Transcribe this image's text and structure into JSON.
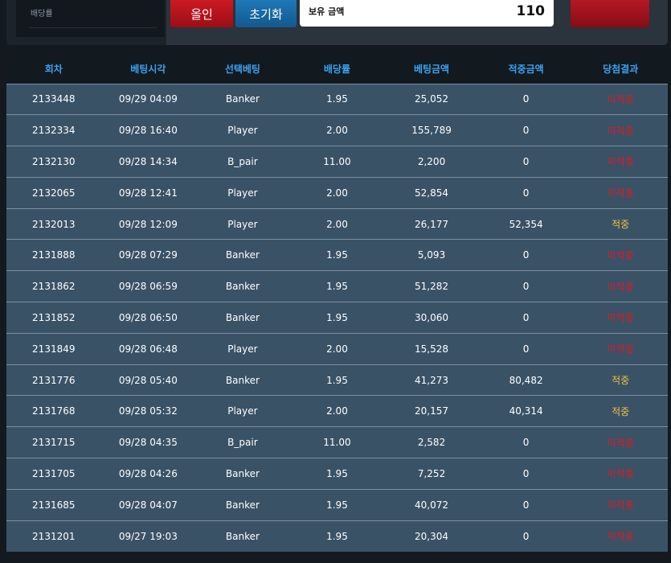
{
  "controls": {
    "odds_label": "배당률",
    "allin_label": "올인",
    "reset_label": "초기화",
    "holding_label": "보유 금액",
    "holding_value": "110"
  },
  "table": {
    "headers": [
      "회차",
      "베팅시각",
      "선택베팅",
      "배당률",
      "베팅금액",
      "적중금액",
      "당첨결과"
    ],
    "rows": [
      [
        "2133448",
        "09/29 04:09",
        "Banker",
        "1.95",
        "25,052",
        "0",
        "미적중"
      ],
      [
        "2132334",
        "09/28 16:40",
        "Player",
        "2.00",
        "155,789",
        "0",
        "미적중"
      ],
      [
        "2132130",
        "09/28 14:34",
        "B_pair",
        "11.00",
        "2,200",
        "0",
        "미적중"
      ],
      [
        "2132065",
        "09/28 12:41",
        "Player",
        "2.00",
        "52,854",
        "0",
        "미적중"
      ],
      [
        "2132013",
        "09/28 12:09",
        "Player",
        "2.00",
        "26,177",
        "52,354",
        "적중"
      ],
      [
        "2131888",
        "09/28 07:29",
        "Banker",
        "1.95",
        "5,093",
        "0",
        "미적중"
      ],
      [
        "2131862",
        "09/28 06:59",
        "Banker",
        "1.95",
        "51,282",
        "0",
        "미적중"
      ],
      [
        "2131852",
        "09/28 06:50",
        "Banker",
        "1.95",
        "30,060",
        "0",
        "미적중"
      ],
      [
        "2131849",
        "09/28 06:48",
        "Player",
        "2.00",
        "15,528",
        "0",
        "미적중"
      ],
      [
        "2131776",
        "09/28 05:40",
        "Banker",
        "1.95",
        "41,273",
        "80,482",
        "적중"
      ],
      [
        "2131768",
        "09/28 05:32",
        "Player",
        "2.00",
        "20,157",
        "40,314",
        "적중"
      ],
      [
        "2131715",
        "09/28 04:35",
        "B_pair",
        "11.00",
        "2,582",
        "0",
        "미적중"
      ],
      [
        "2131705",
        "09/28 04:26",
        "Banker",
        "1.95",
        "7,252",
        "0",
        "미적중"
      ],
      [
        "2131685",
        "09/28 04:07",
        "Banker",
        "1.95",
        "40,072",
        "0",
        "미적중"
      ],
      [
        "2131201",
        "09/27 19:03",
        "Banker",
        "1.95",
        "20,304",
        "0",
        "미적중"
      ]
    ]
  },
  "colors": {
    "header_text": "#3aa3f0",
    "row_bg": "#3a5266",
    "miss": "#e11924",
    "hit": "#f3c13e"
  }
}
